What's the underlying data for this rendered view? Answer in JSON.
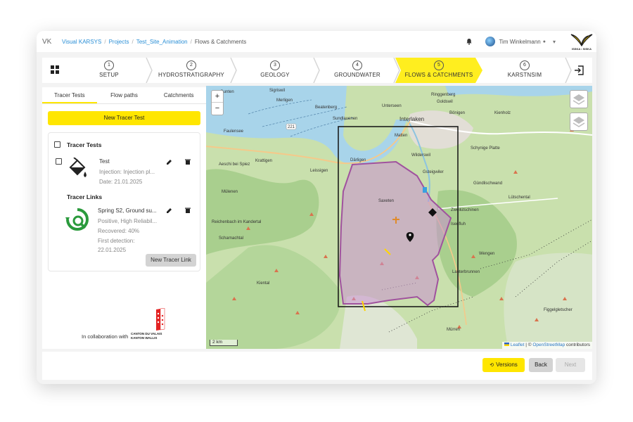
{
  "header": {
    "app_short": "VK",
    "breadcrumb": [
      "Visual KARSYS",
      "Projects",
      "Test_Site_Animation",
      "Flows & Catchments"
    ],
    "user_name": "Tim Winkelmann",
    "logo_text": "ISSKA • SISKA"
  },
  "stepper": {
    "steps": [
      {
        "num": "1",
        "label": "SETUP"
      },
      {
        "num": "2",
        "label": "HYDROSTRATIGRAPHY"
      },
      {
        "num": "3",
        "label": "GEOLOGY"
      },
      {
        "num": "4",
        "label": "GROUNDWATER"
      },
      {
        "num": "5",
        "label": "FLOWS & CATCHMENTS"
      },
      {
        "num": "6",
        "label": "KARSTNSIM"
      }
    ],
    "active_index": 4,
    "active_color": "#ffee1f"
  },
  "sidebar": {
    "tabs": [
      "Tracer Tests",
      "Flow paths",
      "Catchments"
    ],
    "active_tab": "Tracer Tests",
    "new_test_label": "New Tracer Test",
    "tracer_tests_heading": "Tracer Tests",
    "test": {
      "title": "Test",
      "injection": "Injection: Injection pl...",
      "date": "Date: 21.01.2025"
    },
    "tracer_links_heading": "Tracer Links",
    "link": {
      "title": "Spring S2, Ground su...",
      "quality": "Positive, High Reliabil...",
      "recovered": "Recovered: 40%",
      "first_detection_label": "First detection:",
      "first_detection_date": "22.01.2025"
    },
    "new_link_label": "New Tracer Link",
    "collab_text": "In collaboration with",
    "canton_line1": "CANTON DU VALAIS",
    "canton_line2": "KANTON WALLIS"
  },
  "map": {
    "zoom_in": "+",
    "zoom_out": "−",
    "scale_label": "2 km",
    "attribution_leaflet": "Leaflet",
    "attribution_sep": " | © ",
    "attribution_osm": "OpenStreetMap",
    "attribution_tail": " contributors",
    "places": [
      "Interlaken",
      "Unterseen",
      "Beatenberg",
      "Sundlauenen",
      "Merligen",
      "Gunten",
      "Sigriswil",
      "Faulensee",
      "Aeschi bei Spiez",
      "Krattigen",
      "Leissigen",
      "Därligen",
      "Wilderswil",
      "Gsteigwiler",
      "Saxeten",
      "Zweilütschinen",
      "Isenfluh",
      "Lütschental",
      "Wengen",
      "Lauterbrunnen",
      "Mürren",
      "Reichenbach im Kandertal",
      "Scharnachtal",
      "Kiental",
      "Mülenen",
      "Bönigen",
      "Ringgenberg",
      "Goldswil",
      "Matten",
      "Gündlischwand",
      "Figgelgletscher",
      "Schynige Platte",
      "Kienholz"
    ],
    "road_number": "221",
    "polygon_color": "#c98fcf",
    "water_color": "#a8d4ea"
  },
  "footer": {
    "versions_label": "Versions",
    "back_label": "Back",
    "next_label": "Next"
  }
}
